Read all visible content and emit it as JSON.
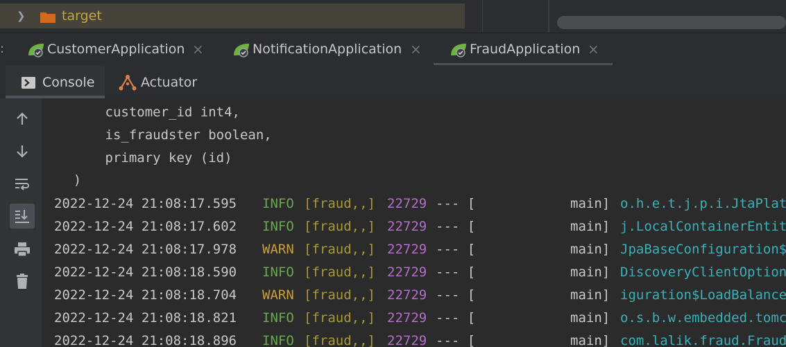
{
  "project_tree": {
    "folder_label": "target"
  },
  "run_tabs": [
    {
      "label": "CustomerApplication",
      "active": false
    },
    {
      "label": "NotificationApplication",
      "active": false
    },
    {
      "label": "FraudApplication",
      "active": true
    }
  ],
  "run_tabs_prefix": ":",
  "close_glyph": "×",
  "sub_tabs": {
    "console": "Console",
    "actuator": "Actuator"
  },
  "toolbar_icons": [
    "arrow-up-icon",
    "arrow-down-icon",
    "soft-wrap-icon",
    "scroll-to-end-icon",
    "print-icon",
    "trash-icon"
  ],
  "console_lines": [
    "        customer_id int4,",
    "        is_fraudster boolean,",
    "        primary key (id)",
    "    )"
  ],
  "log_rows": [
    {
      "timestamp": "2022-12-24 21:08:17.595",
      "level": "INFO",
      "app": "[fraud,,]",
      "pid": "22729",
      "sep": "--- [",
      "thread": "main]",
      "logger": "o.h.e.t.j.p.i.JtaPlatformInitiator"
    },
    {
      "timestamp": "2022-12-24 21:08:17.602",
      "level": "INFO",
      "app": "[fraud,,]",
      "pid": "22729",
      "sep": "--- [",
      "thread": "main]",
      "logger": "j.LocalContainerEntityManagerFactoryBean"
    },
    {
      "timestamp": "2022-12-24 21:08:17.978",
      "level": "WARN",
      "app": "[fraud,,]",
      "pid": "22729",
      "sep": "--- [",
      "thread": "main]",
      "logger": "JpaBaseConfiguration$JpaWebConfiguration"
    },
    {
      "timestamp": "2022-12-24 21:08:18.590",
      "level": "INFO",
      "app": "[fraud,,]",
      "pid": "22729",
      "sep": "--- [",
      "thread": "main]",
      "logger": "DiscoveryClientOptionalArgsConfiguration"
    },
    {
      "timestamp": "2022-12-24 21:08:18.704",
      "level": "WARN",
      "app": "[fraud,,]",
      "pid": "22729",
      "sep": "--- [",
      "thread": "main]",
      "logger": "iguration$LoadBalancerCaffeineWarnLogger"
    },
    {
      "timestamp": "2022-12-24 21:08:18.821",
      "level": "INFO",
      "app": "[fraud,,]",
      "pid": "22729",
      "sep": "--- [",
      "thread": "main]",
      "logger": "o.s.b.w.embedded.tomcat.TomcatWebServer"
    },
    {
      "timestamp": "2022-12-24 21:08:18.896",
      "level": "INFO",
      "app": "[fraud,,]",
      "pid": "22729",
      "sep": "--- [",
      "thread": "main]",
      "logger": "com.lalik.fraud.FraudApplication"
    }
  ],
  "colors": {
    "info": "#6aa84f",
    "warn": "#c8a13b",
    "app": "#a89a35",
    "pid": "#b46ec9",
    "logger": "#3bb0b8",
    "folder": "#d2691e",
    "spring_green": "#6db33f"
  }
}
